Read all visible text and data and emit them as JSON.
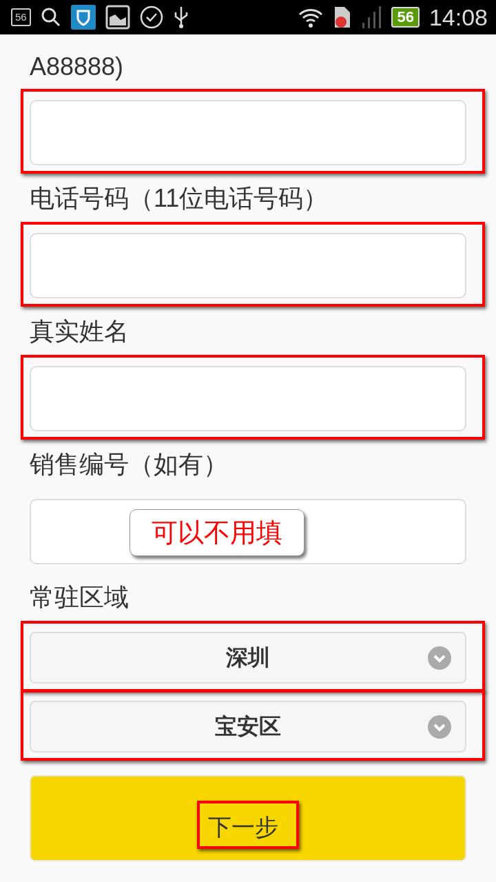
{
  "status_bar": {
    "notification_count": "56",
    "battery": "56",
    "time": "14:08"
  },
  "form": [
    {
      "kind": "label",
      "text": "A88888)"
    },
    {
      "kind": "input",
      "highlighted": true
    },
    {
      "kind": "label",
      "text": "电话号码（11位电话号码）"
    },
    {
      "kind": "input",
      "highlighted": true
    },
    {
      "kind": "label",
      "text": "真实姓名"
    },
    {
      "kind": "input",
      "highlighted": true
    },
    {
      "kind": "label",
      "text": "销售编号（如有）"
    },
    {
      "kind": "input",
      "highlighted": false,
      "note": "可以不用填"
    },
    {
      "kind": "label",
      "text": "常驻区域"
    },
    {
      "kind": "select",
      "value": "深圳",
      "highlighted": true
    },
    {
      "kind": "select",
      "value": "宝安区",
      "highlighted": true
    }
  ],
  "button": {
    "label": "下一步",
    "highlighted": true
  }
}
